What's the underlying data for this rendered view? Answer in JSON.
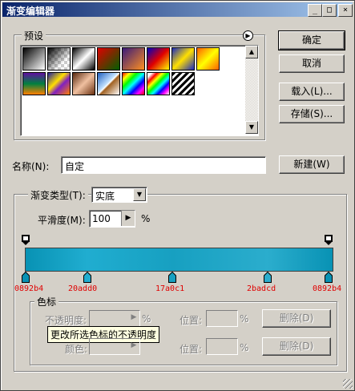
{
  "window": {
    "title": "渐变编辑器"
  },
  "titlebar_buttons": {
    "min": "_",
    "max": "□",
    "close": "×"
  },
  "buttons": {
    "ok": "确定",
    "cancel": "取消",
    "load": "载入(L)...",
    "save": "存储(S)...",
    "new": "新建(W)",
    "delete1": "删除(D)",
    "delete2": "删除(D)"
  },
  "presets": {
    "label": "预设",
    "row1": [
      "black-to-white",
      "black-to-transparent",
      "black-white-black",
      "red-green",
      "violet-orange",
      "blue-red-yellow",
      "blue-yellow-blue",
      "orange-yellow-orange"
    ],
    "row2": [
      "violet-green-orange",
      "yellow-violet-orange-blue",
      "copper",
      "chrome",
      "spectrum",
      "transparent-rainbow",
      "transparent-stripes"
    ]
  },
  "name": {
    "label": "名称(N):",
    "value": "自定"
  },
  "type": {
    "label": "渐变类型(T):",
    "value": "实底"
  },
  "smoothness": {
    "label": "平滑度(M):",
    "value": "100",
    "unit": "%"
  },
  "stops": {
    "colors": [
      "0892b4",
      "20add0",
      "17a0c1",
      "2badcd",
      "0892b4"
    ],
    "label_colors": "#e00000"
  },
  "color_section": {
    "label": "色标",
    "opacity_label": "不透明度:",
    "percent": "%",
    "position_label": "位置:",
    "color_label": "颜色:",
    "tooltip": "更改所选色标的不透明度"
  }
}
